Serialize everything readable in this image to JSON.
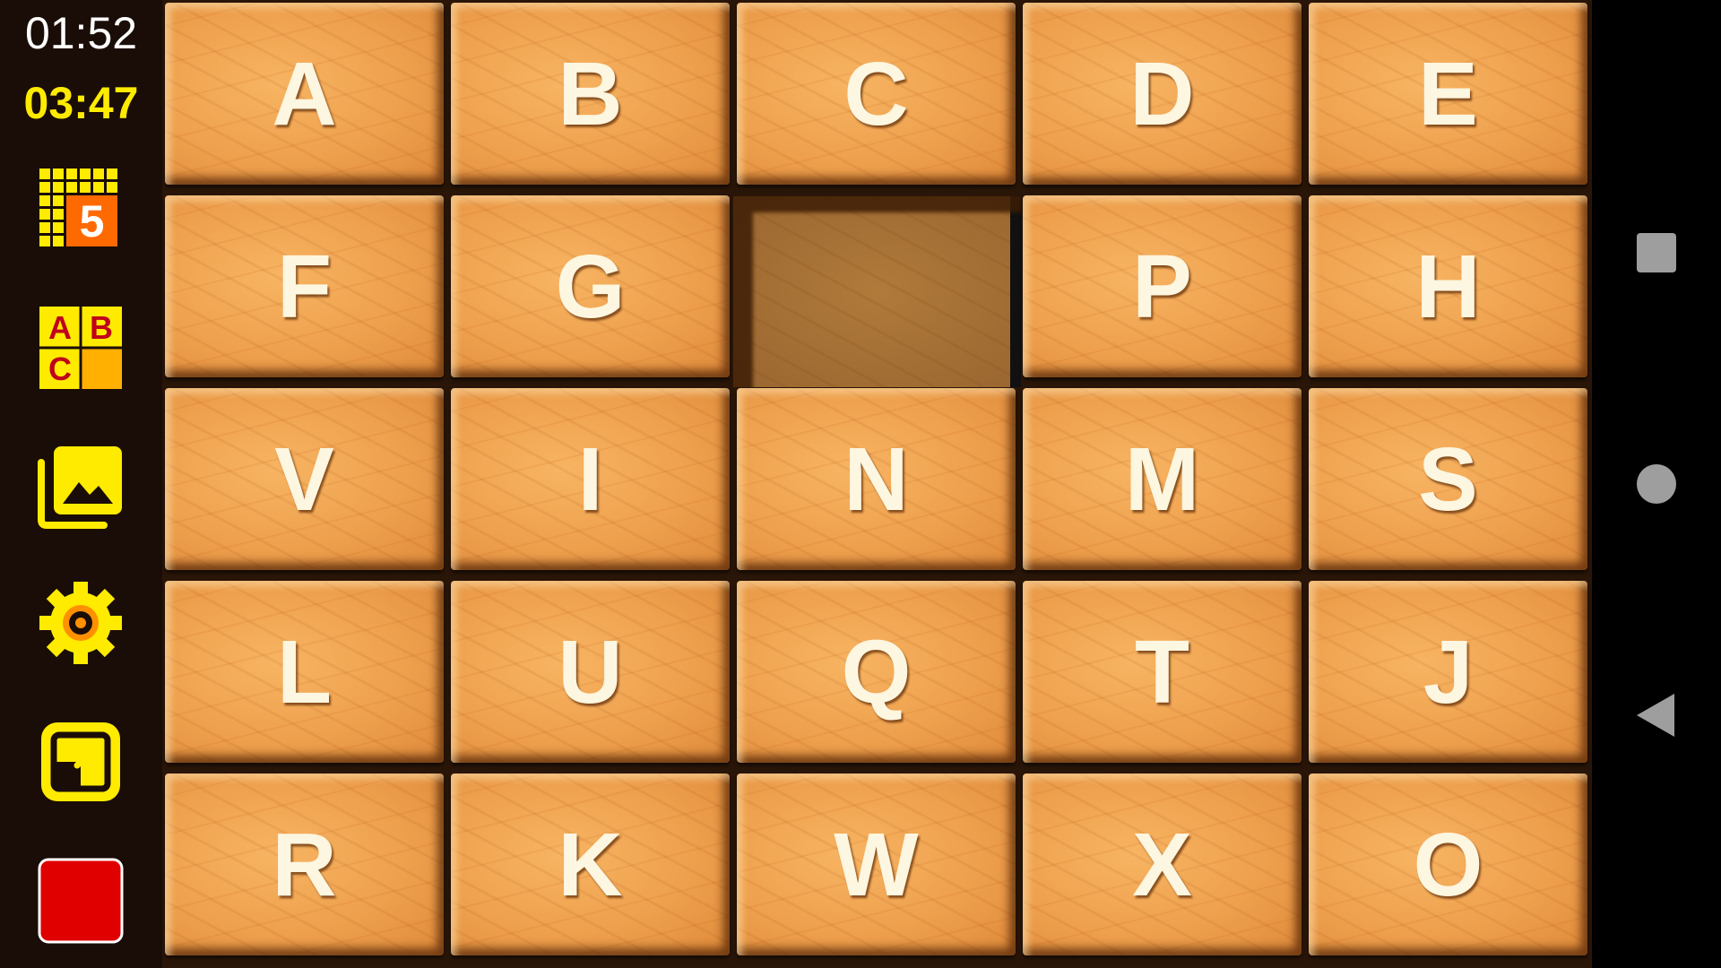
{
  "status": {
    "clock": "01:52",
    "timer": "03:47"
  },
  "sidebar": {
    "buttons": [
      {
        "name": "board-size-button",
        "icon": "grid-size-icon",
        "value": "5"
      },
      {
        "name": "tile-style-button",
        "icon": "abc-letters-icon",
        "letters": [
          "A",
          "B",
          "C"
        ]
      },
      {
        "name": "image-gallery-button",
        "icon": "image-gallery-icon"
      },
      {
        "name": "settings-button",
        "icon": "gear-icon"
      },
      {
        "name": "exit-fullscreen-button",
        "icon": "open-external-icon"
      },
      {
        "name": "stop-button",
        "icon": "red-square-icon"
      }
    ]
  },
  "board": {
    "size": 5,
    "rows": [
      [
        "A",
        "B",
        "C",
        "D",
        "E"
      ],
      [
        "F",
        "G",
        "",
        "P",
        "H"
      ],
      [
        "V",
        "I",
        "N",
        "M",
        "S"
      ],
      [
        "L",
        "U",
        "Q",
        "T",
        "J"
      ],
      [
        "R",
        "K",
        "W",
        "X",
        "O"
      ]
    ]
  },
  "navbar": {
    "buttons": [
      {
        "name": "recents-button",
        "icon": "square-icon"
      },
      {
        "name": "home-button",
        "icon": "circle-icon"
      },
      {
        "name": "back-button",
        "icon": "triangle-back-icon"
      }
    ]
  },
  "colors": {
    "sidebar_bg": "#1a0d07",
    "timer": "#ffeb00",
    "clock": "#ffffff",
    "tile_letter": "#fdf6e0",
    "icon_yellow": "#ffeb00",
    "stop_red": "#e00000"
  }
}
